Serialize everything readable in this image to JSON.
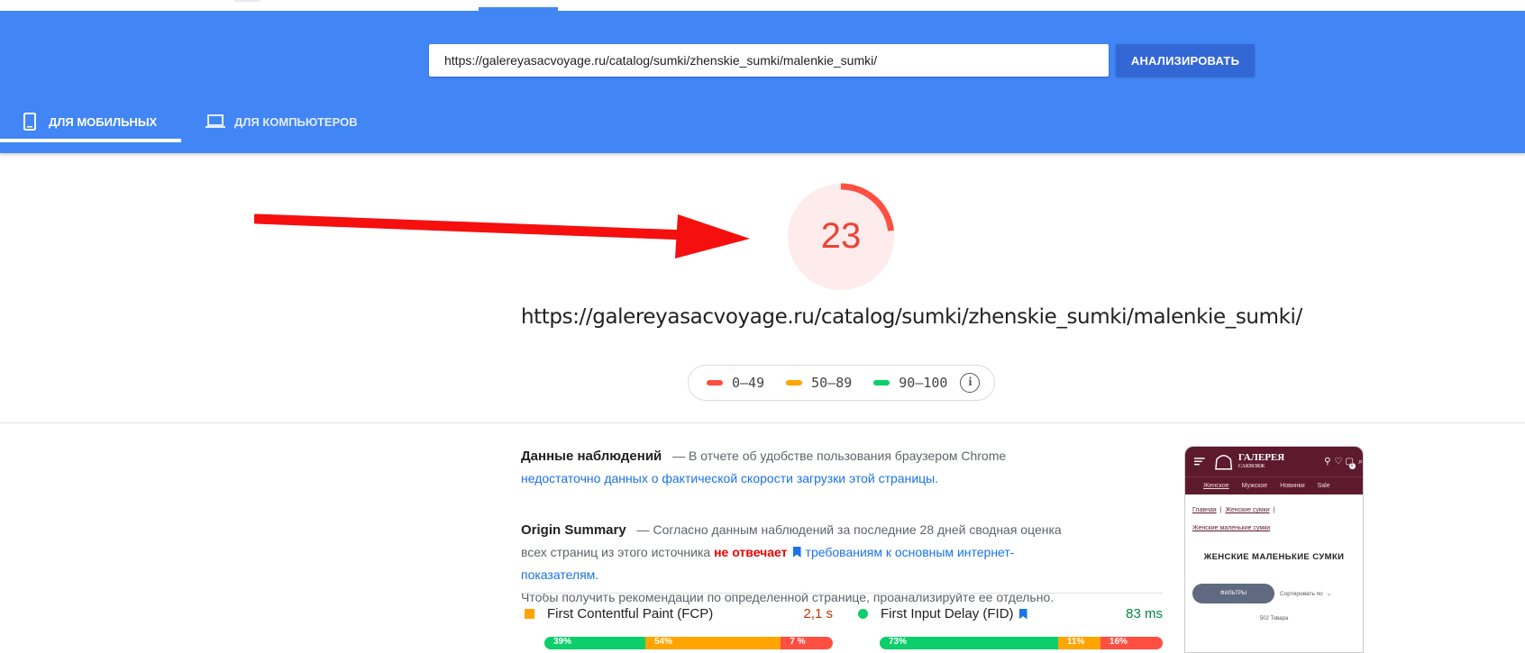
{
  "header": {
    "url_value": "https://galereyasacvoyage.ru/catalog/sumki/zhenskie_sumki/malenkie_sumki/",
    "analyze_label": "АНАЛИЗИРОВАТЬ",
    "tabs": [
      {
        "label": "ДЛЯ МОБИЛЬНЫХ",
        "icon": "smartphone-icon",
        "active": true
      },
      {
        "label": "ДЛЯ КОМПЬЮТЕРОВ",
        "icon": "laptop-icon",
        "active": false
      }
    ],
    "color": "#4285f4"
  },
  "score": {
    "value": "23",
    "fraction": 0.23,
    "color": "#eb4335"
  },
  "page_url": "https://galereyasacvoyage.ru/catalog/sumki/zhenskie_sumki/malenkie_sumki/",
  "legend": {
    "ranges": [
      {
        "label": "0–49",
        "color": "#ff4e42"
      },
      {
        "label": "50–89",
        "color": "#ffa400"
      },
      {
        "label": "90–100",
        "color": "#0cce6b"
      }
    ],
    "info_icon": "info-icon"
  },
  "field_data": {
    "title": "Данные наблюдений",
    "text": "— В отчете об удобстве пользования браузером Chrome",
    "link": "недостаточно данных о фактической скорости загрузки этой страницы."
  },
  "origin_summary": {
    "title": "Origin Summary",
    "text_1": "— Согласно данным наблюдений за последние 28 дней сводная оценка всех страниц из этого источника",
    "status": "не отвечает",
    "link": "требованиям к основным интернет-показателям.",
    "text_2": "Чтобы получить рекомендации по определенной странице, проанализируйте ее отдельно."
  },
  "metrics": [
    {
      "name": "First Contentful Paint (FCP)",
      "value": "2,1 s",
      "value_color": "#c33300",
      "marker": "square",
      "marker_color": "#ffa400",
      "dist": [
        "39%",
        "54%",
        "7 %"
      ],
      "dist_fractions": [
        0.39,
        0.54,
        0.07
      ]
    },
    {
      "name": "First Input Delay (FID)",
      "value": "83 ms",
      "value_color": "#018642",
      "marker": "circle",
      "marker_color": "#0cce6b",
      "dist": [
        "73%",
        "11%",
        "16%"
      ],
      "dist_fractions": [
        0.73,
        0.11,
        0.16
      ]
    }
  ],
  "preview": {
    "logo_title": "ГАЛЕРЕЯ",
    "logo_sub": "САКВОЯЖ",
    "cart_count": "0",
    "categories": [
      "Женское",
      "Мужское",
      "Новинки",
      "Sale"
    ],
    "breadcrumbs": [
      "Главная",
      "|",
      "Женские сумки",
      "|"
    ],
    "breadcrumb_2": "Женские маленькие сумки",
    "page_title": "ЖЕНСКИЕ МАЛЕНЬКИЕ СУМКИ",
    "filters_label": "ФИЛЬТРЫ",
    "sort_label": "Сортировать по",
    "count": "502 Товара"
  }
}
